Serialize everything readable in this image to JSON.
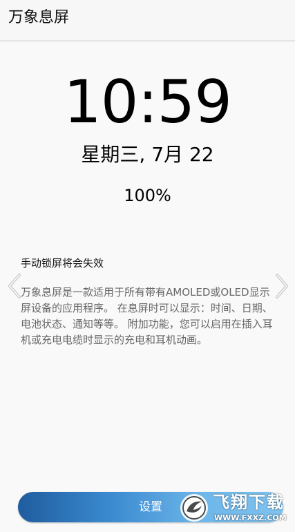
{
  "app_bar": {
    "title": "万象息屏"
  },
  "clock": {
    "time": "10:59",
    "date": "星期三, 7月 22",
    "battery": "100%"
  },
  "info_card": {
    "lock_warning": "手动锁屏将会失效",
    "description": "万象息屏是一款适用于所有带有AMOLED或OLED显示屏设备的应用程序。 在息屏时可以显示：时间、日期、电池状态、通知等等。 附加功能，您可以启用在插入耳机或充电电缆时显示的充电和耳机动画。"
  },
  "navigation": {
    "previous_icon": "chevron-left-icon",
    "next_icon": "chevron-right-icon"
  },
  "settings_button": {
    "label": "设置"
  },
  "watermark": {
    "brand": "飞翔下载",
    "url": "WWW.FXXZ.COM"
  },
  "colors": {
    "button_gradient_start": "#1f5c9e",
    "button_gradient_end": "#7fc2ee",
    "background": "#f9f9f9",
    "secondary_text": "#666666"
  }
}
